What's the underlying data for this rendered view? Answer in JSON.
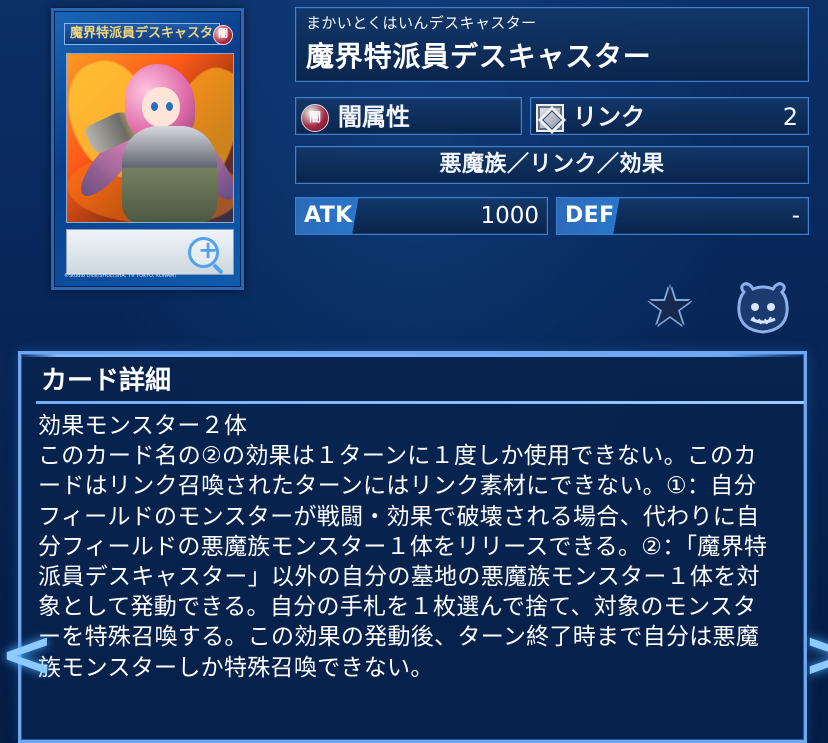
{
  "card": {
    "image_name_plate": "魔界特派員デスキャスター",
    "image_attribute_mark": "闇",
    "image_footer_text": "©Studio Dice/SHUEISHA, TV TOKYO, KONAMI"
  },
  "title": {
    "reading": "まかいとくはいんデスキャスター",
    "name": "魔界特派員デスキャスター"
  },
  "attributes": {
    "attribute_label": "闇属性",
    "attribute_icon_text": "闇",
    "link_label": "リンク",
    "link_value": "2",
    "type_line": "悪魔族／リンク／効果"
  },
  "stats": {
    "atk_label": "ATK",
    "atk_value": "1000",
    "def_label": "DEF",
    "def_value": "-"
  },
  "actions": {
    "favorite_icon": "star-icon",
    "deck_icon": "pot-icon",
    "zoom_icon": "zoom-icon"
  },
  "details": {
    "title": "カード詳細",
    "body": "効果モンスター２体\nこのカード名の②の効果は１ターンに１度しか使用できない。このカードはリンク召喚されたターンにはリンク素材にできない。①：自分フィールドのモンスターが戦闘・効果で破壊される場合、代わりに自分フィールドの悪魔族モンスター１体をリリースできる。②：「魔界特派員デスキャスター」以外の自分の墓地の悪魔族モンスター１体を対象として発動できる。自分の手札を１枚選んで捨て、対象のモンスターを特殊召喚する。この効果の発動後、ターン終了時まで自分は悪魔族モンスターしか特殊召喚できない。"
  },
  "navigation": {
    "left": "<",
    "right": ">"
  },
  "colors": {
    "panel_border": "#3e80ce",
    "detail_border": "#6ea7ef",
    "highlight": "#8dcaff"
  }
}
